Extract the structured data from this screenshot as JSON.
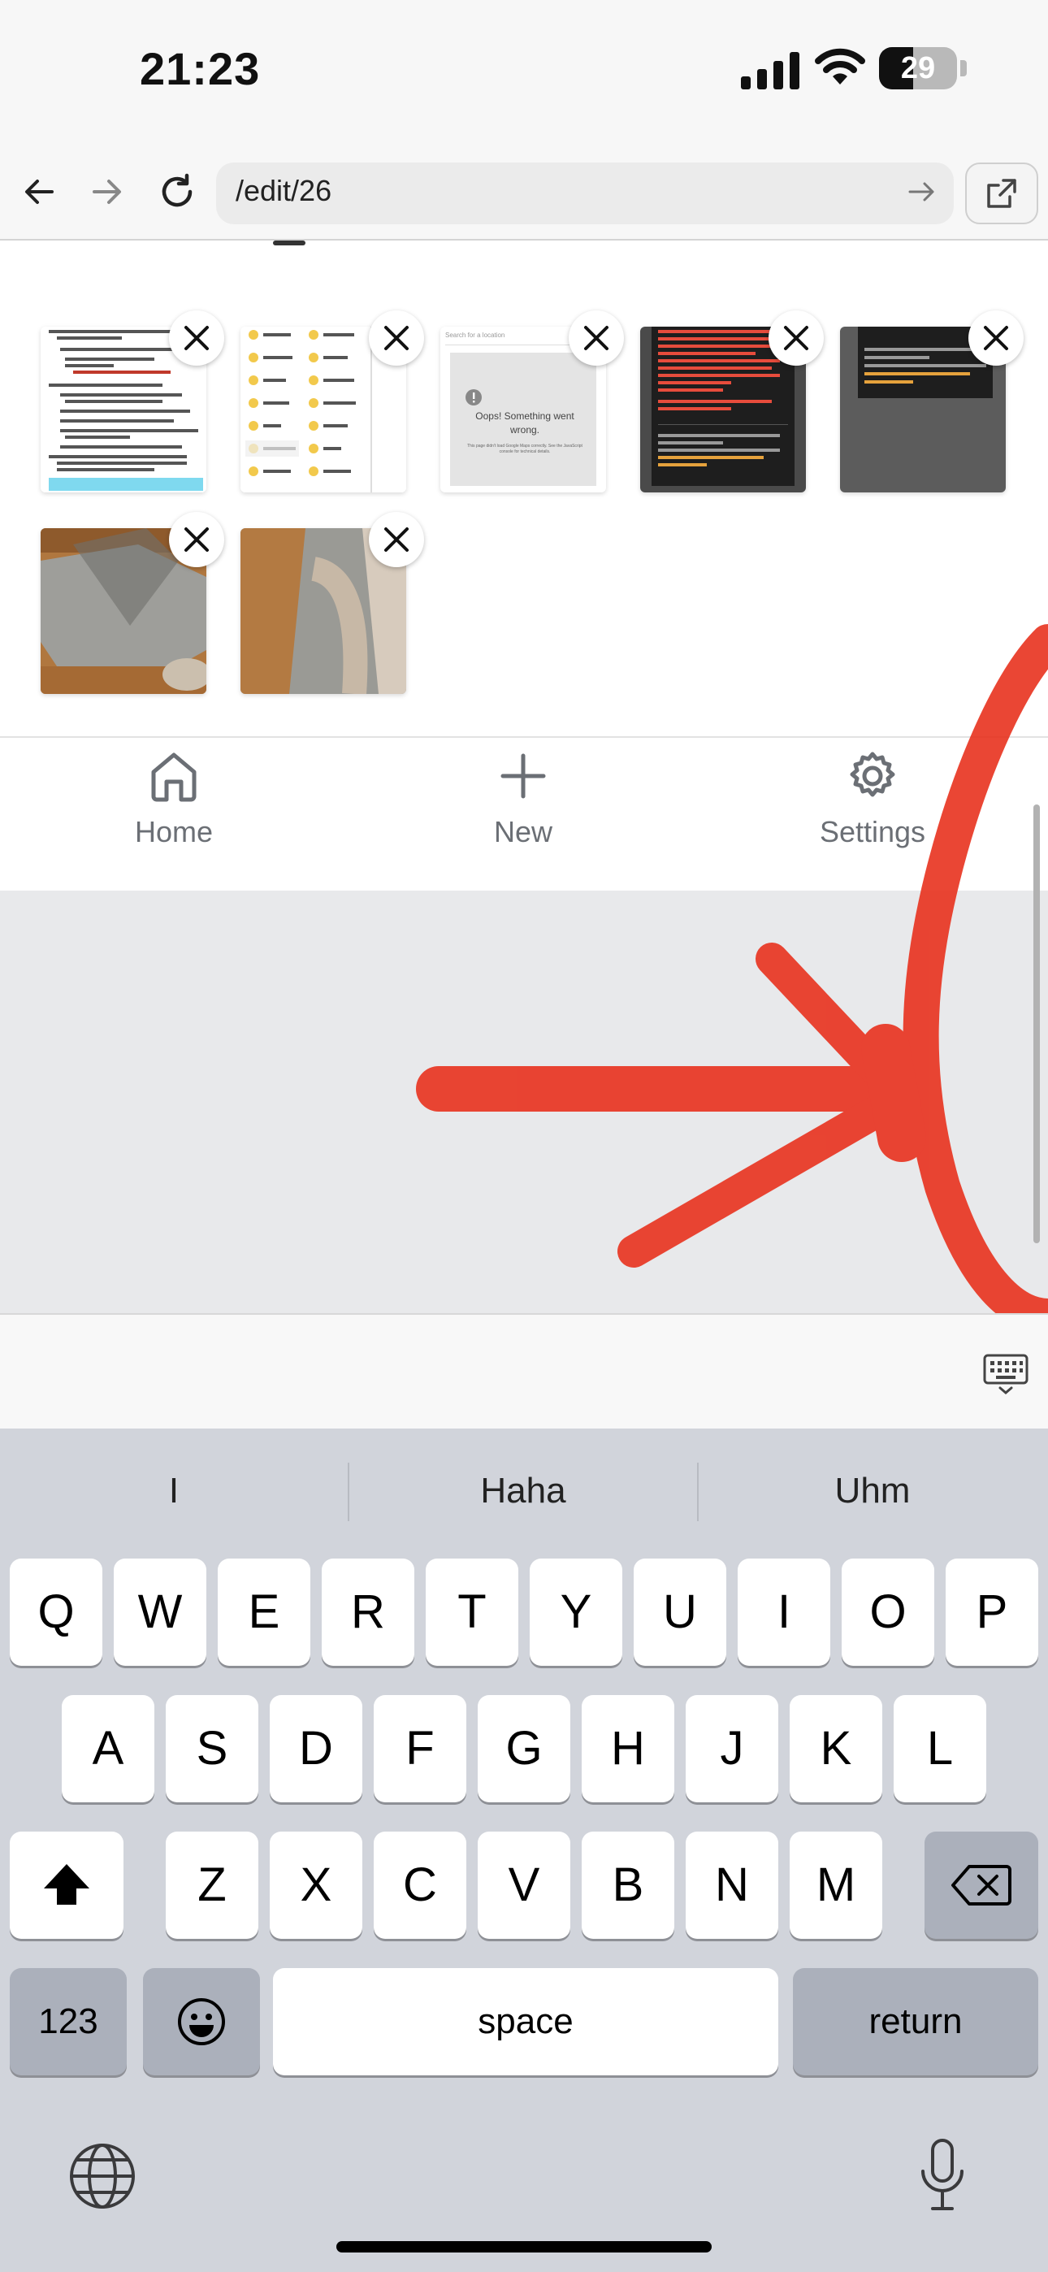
{
  "status_bar": {
    "time": "21:23",
    "battery": "29"
  },
  "browser": {
    "url": "/edit/26"
  },
  "thumbnails": [
    {
      "kind": "instructions-doc"
    },
    {
      "kind": "mood-list"
    },
    {
      "kind": "error-card",
      "search_placeholder": "Search for a location",
      "message": "Oops! Something went wrong.",
      "detail": "This page didn't load Google Maps correctly. See the JavaScript console for technical details."
    },
    {
      "kind": "terminal-error"
    },
    {
      "kind": "terminal-overlay"
    },
    {
      "kind": "photo-floor"
    },
    {
      "kind": "photo-floor-2"
    }
  ],
  "bottom_nav": {
    "items": [
      {
        "label": "Home",
        "icon": "home-icon"
      },
      {
        "label": "New",
        "icon": "plus-icon"
      },
      {
        "label": "Settings",
        "icon": "gear-icon"
      }
    ]
  },
  "keyboard": {
    "suggestions": [
      "I",
      "Haha",
      "Uhm"
    ],
    "row1": [
      "Q",
      "W",
      "E",
      "R",
      "T",
      "Y",
      "U",
      "I",
      "O",
      "P"
    ],
    "row2": [
      "A",
      "S",
      "D",
      "F",
      "G",
      "H",
      "J",
      "K",
      "L"
    ],
    "row3": [
      "Z",
      "X",
      "C",
      "V",
      "B",
      "N",
      "M"
    ],
    "numbers_key": "123",
    "space_key": "space",
    "return_key": "return"
  },
  "colors": {
    "annotation_red": "#e8321e",
    "grey_area": "#e8e9eb",
    "keyboard_bg": "#d1d4db"
  }
}
